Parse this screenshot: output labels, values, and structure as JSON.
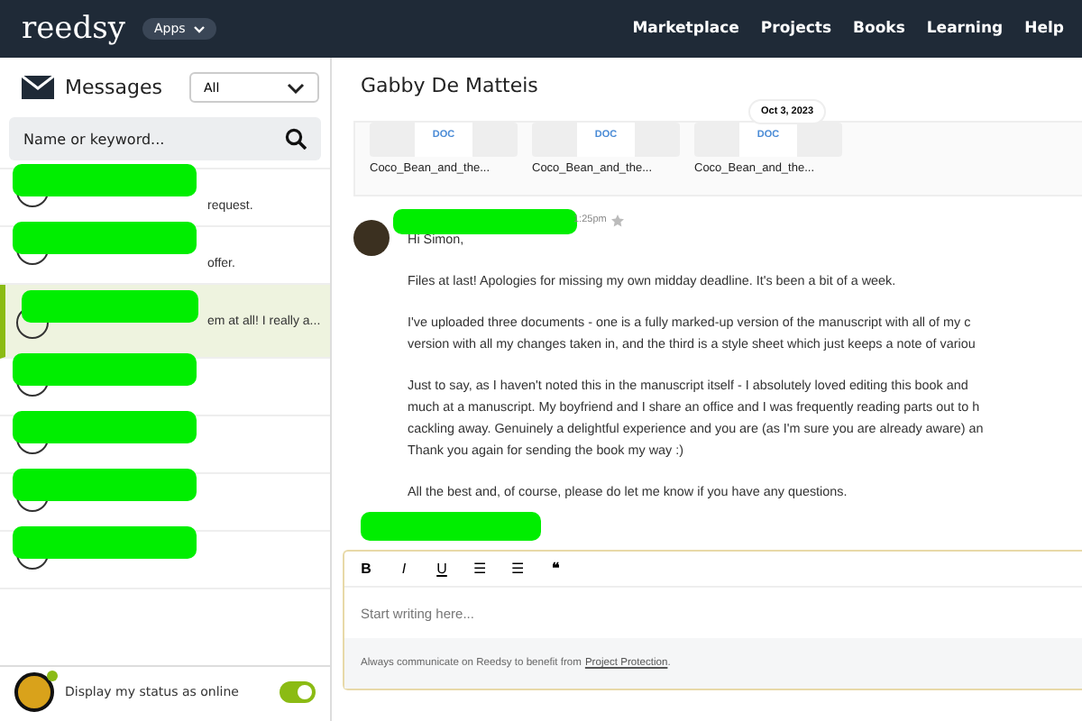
{
  "topbar": {
    "logo": "reedsy",
    "apps": "Apps",
    "nav": [
      "Marketplace",
      "Projects",
      "Books",
      "Learning",
      "Help"
    ]
  },
  "sidebar": {
    "title": "Messages",
    "filter": "All",
    "search": {
      "placeholder": "Name or keyword..."
    },
    "conversations": [
      {
        "preview": "request.",
        "selected": false,
        "redacted": true
      },
      {
        "preview": "offer.",
        "selected": false,
        "redacted": true
      },
      {
        "preview": "em at all! I really a...",
        "selected": true,
        "redacted": true
      },
      {
        "selected": false,
        "redacted": true
      },
      {
        "selected": false,
        "redacted": true
      },
      {
        "selected": false,
        "redacted": true
      },
      {
        "selected": false,
        "redacted": true
      }
    ],
    "status": {
      "label": "Display my status as online",
      "on": true
    }
  },
  "conversation": {
    "title": "Gabby De Matteis",
    "attachments": [
      {
        "type": "DOC",
        "name": "Coco_Bean_and_the..."
      },
      {
        "type": "DOC",
        "name": "Coco_Bean_and_the..."
      },
      {
        "type": "DOC",
        "name": "Coco_Bean_and_the..."
      }
    ],
    "date": "Oct 3, 2023",
    "message": {
      "time": "1:25pm",
      "sender_redacted": true,
      "paragraphs": [
        [
          "Hi Simon,"
        ],
        [
          "Files at last! Apologies for missing my own midday deadline. It's been a bit of a week."
        ],
        [
          "I've uploaded three documents - one is a fully marked-up version of the manuscript with all of my c",
          "version with all my changes taken in, and the third is a style sheet which just keeps a note of variou"
        ],
        [
          "Just to say, as I haven't noted this in the manuscript itself - I absolutely loved editing this book and",
          "much at a manuscript. My boyfriend and I share an office and I was frequently reading parts out to h",
          "cackling away. Genuinely a delightful experience and you are (as I'm sure you are already aware) an",
          "Thank you again for sending the book my way :)"
        ],
        [
          "All the best and, of course, please do let me know if you have any questions."
        ]
      ]
    },
    "reply_redacted": true,
    "composer": {
      "tools": [
        "B",
        "I",
        "U",
        "☰",
        "☰",
        "❝"
      ],
      "placeholder": "Start writing here...",
      "note": "Always communicate on Reedsy to benefit from ",
      "link": "Project Protection",
      "note_end": "."
    }
  }
}
